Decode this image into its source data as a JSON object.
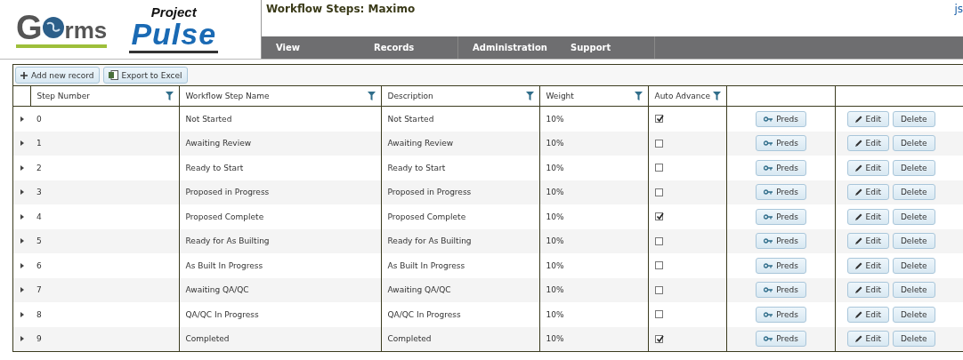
{
  "logos": {
    "gforms": {
      "first": "G",
      "rest": "rms"
    },
    "pulse": {
      "top": "Project",
      "main": "Pulse"
    }
  },
  "page_title": "Workflow Steps: Maximo",
  "user_link": "js",
  "nav": [
    {
      "label": "View"
    },
    {
      "label": "Records"
    },
    {
      "label": "Administration"
    },
    {
      "label": "Support"
    }
  ],
  "toolbar": [
    {
      "kind": "add",
      "label": "Add new record"
    },
    {
      "kind": "excel",
      "label": "Export to Excel"
    }
  ],
  "table": {
    "columns": [
      {
        "label": "Step Number"
      },
      {
        "label": "Workflow Step Name"
      },
      {
        "label": "Description"
      },
      {
        "label": "Weight"
      },
      {
        "label": "Auto Advance"
      }
    ],
    "rows": [
      {
        "step": "0",
        "name": "Not Started",
        "description": "Not Started",
        "weight": "10%",
        "auto_advance": true,
        "preds": "Preds",
        "edit": "Edit",
        "delete": "Delete"
      },
      {
        "step": "1",
        "name": "Awaiting Review",
        "description": "Awaiting Review",
        "weight": "10%",
        "auto_advance": false,
        "preds": "Preds",
        "edit": "Edit",
        "delete": "Delete"
      },
      {
        "step": "2",
        "name": "Ready to Start",
        "description": "Ready to Start",
        "weight": "10%",
        "auto_advance": false,
        "preds": "Preds",
        "edit": "Edit",
        "delete": "Delete"
      },
      {
        "step": "3",
        "name": "Proposed in Progress",
        "description": "Proposed in Progress",
        "weight": "10%",
        "auto_advance": false,
        "preds": "Preds",
        "edit": "Edit",
        "delete": "Delete"
      },
      {
        "step": "4",
        "name": "Proposed Complete",
        "description": "Proposed Complete",
        "weight": "10%",
        "auto_advance": true,
        "preds": "Preds",
        "edit": "Edit",
        "delete": "Delete"
      },
      {
        "step": "5",
        "name": "Ready for As Builting",
        "description": "Ready for As Builting",
        "weight": "10%",
        "auto_advance": false,
        "preds": "Preds",
        "edit": "Edit",
        "delete": "Delete"
      },
      {
        "step": "6",
        "name": "As Built In Progress",
        "description": "As Built In Progress",
        "weight": "10%",
        "auto_advance": false,
        "preds": "Preds",
        "edit": "Edit",
        "delete": "Delete"
      },
      {
        "step": "7",
        "name": "Awaiting QA/QC",
        "description": "Awaiting QA/QC",
        "weight": "10%",
        "auto_advance": false,
        "preds": "Preds",
        "edit": "Edit",
        "delete": "Delete"
      },
      {
        "step": "8",
        "name": "QA/QC In Progress",
        "description": "QA/QC In Progress",
        "weight": "10%",
        "auto_advance": false,
        "preds": "Preds",
        "edit": "Edit",
        "delete": "Delete"
      },
      {
        "step": "9",
        "name": "Completed",
        "description": "Completed",
        "weight": "10%",
        "auto_advance": true,
        "preds": "Preds",
        "edit": "Edit",
        "delete": "Delete"
      }
    ]
  }
}
